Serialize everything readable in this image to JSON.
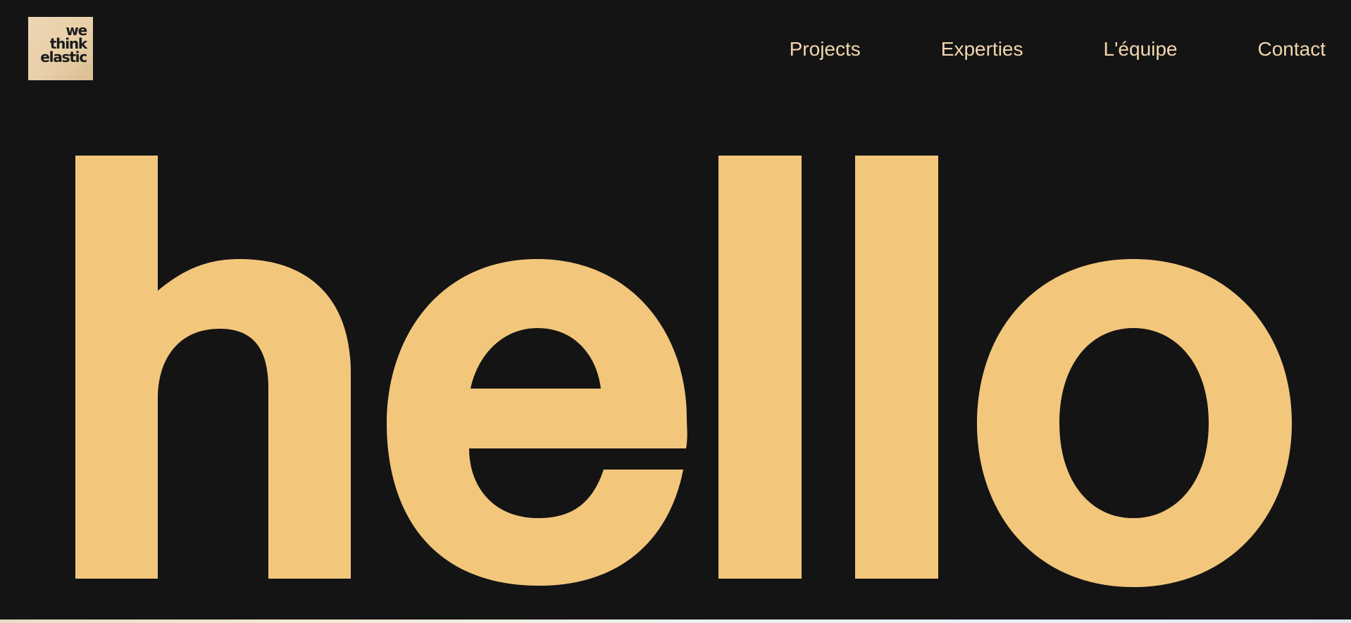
{
  "logo": {
    "line1": "we",
    "line2": "think",
    "line3": "elastic"
  },
  "nav": {
    "items": [
      {
        "label": "Projects"
      },
      {
        "label": "Experties"
      },
      {
        "label": "L'équipe"
      },
      {
        "label": "Contact"
      }
    ]
  },
  "hero": {
    "headline": "hello"
  },
  "colors": {
    "background": "#141414",
    "accent": "#f2c77c",
    "nav_text": "#f3d6ae",
    "logo_bg": "#e8cfa8"
  }
}
